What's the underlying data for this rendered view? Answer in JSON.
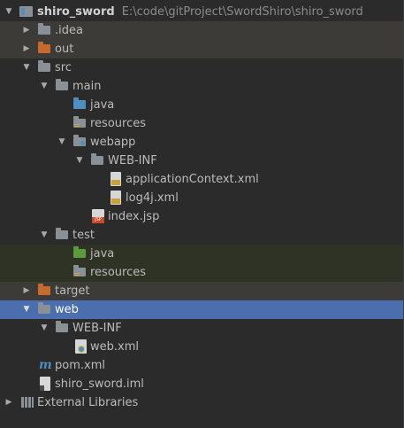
{
  "project": {
    "name": "shiro_sword",
    "path": "E:\\code\\gitProject\\SwordShiro\\shiro_sword"
  },
  "tree": {
    "idea": ".idea",
    "out": "out",
    "src": "src",
    "main": "main",
    "main_java": "java",
    "main_resources": "resources",
    "webapp": "webapp",
    "webapp_webinf": "WEB-INF",
    "application_context": "applicationContext.xml",
    "log4j": "log4j.xml",
    "index_jsp": "index.jsp",
    "test": "test",
    "test_java": "java",
    "test_resources": "resources",
    "target": "target",
    "web": "web",
    "web_webinf": "WEB-INF",
    "web_xml": "web.xml",
    "pom": "pom.xml",
    "iml": "shiro_sword.iml",
    "external_libraries": "External Libraries"
  },
  "icons": {
    "expanded": "chevron-down-icon",
    "collapsed": "chevron-right-icon",
    "folder": "folder-icon",
    "file": "file-icon"
  },
  "colors": {
    "background": "#2b2b2b",
    "selection": "#4b6eaf",
    "excluded_folder": "#c76a2d",
    "source_folder": "#4e8fc2",
    "test_folder": "#5a9a3c"
  }
}
